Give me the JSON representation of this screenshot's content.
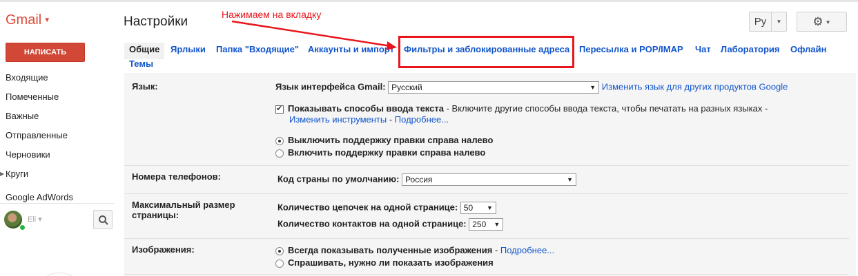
{
  "header": {
    "logo": "Gmail",
    "page_title": "Настройки",
    "annotation": "Нажимаем на вкладку",
    "lang_button": "Ру",
    "accent_color": "#dd4b39",
    "annotation_color": "#e8161c"
  },
  "sidebar": {
    "compose_label": "НАПИСАТЬ",
    "items": [
      {
        "label": "Входящие"
      },
      {
        "label": "Помеченные"
      },
      {
        "label": "Важные"
      },
      {
        "label": "Отправленные"
      },
      {
        "label": "Черновики"
      },
      {
        "label": "Круги"
      }
    ],
    "adwords": "Google AdWords",
    "chat_user": "Eli"
  },
  "tabs": [
    {
      "label": "Общие",
      "active": true
    },
    {
      "label": "Ярлыки"
    },
    {
      "label": "Папка \"Входящие\""
    },
    {
      "label": "Аккаунты и импорт"
    },
    {
      "label": "Фильтры и заблокированные адреса",
      "highlighted": true
    },
    {
      "label": "Пересылка и POP/IMAP"
    },
    {
      "label": "Чат"
    },
    {
      "label": "Лаборатория"
    },
    {
      "label": "Офлайн"
    },
    {
      "label": "Темы"
    }
  ],
  "settings": {
    "language": {
      "label": "Язык:",
      "interface_label": "Язык интерфейса Gmail:",
      "interface_value": "Русский",
      "change_link": "Изменить язык для других продуктов Google",
      "input_tools_bold": "Показывать способы ввода текста",
      "input_tools_text": " - Включите другие способы ввода текста, чтобы печатать на разных языках -",
      "input_tools_checked": true,
      "edit_tools_link": "Изменить инструменты",
      "sep": " - ",
      "more_link": "Подробнее...",
      "rtl_off": "Выключить поддержку правки справа налево",
      "rtl_on": "Включить поддержку правки справа налево",
      "rtl_selected": "off"
    },
    "phone": {
      "label": "Номера телефонов:",
      "country_label": "Код страны по умолчанию:",
      "country_value": "Россия"
    },
    "page_size": {
      "label_line1": "Максимальный размер",
      "label_line2": "страницы:",
      "threads_label": "Количество цепочек на одной странице:",
      "threads_value": "50",
      "contacts_label": "Количество контактов на одной странице:",
      "contacts_value": "250"
    },
    "images": {
      "label": "Изображения:",
      "always_show": "Всегда показывать полученные изображения",
      "sep": " - ",
      "more_link": "Подробнее...",
      "ask": "Спрашивать, нужно ли показать изображения",
      "selected": "always"
    }
  }
}
